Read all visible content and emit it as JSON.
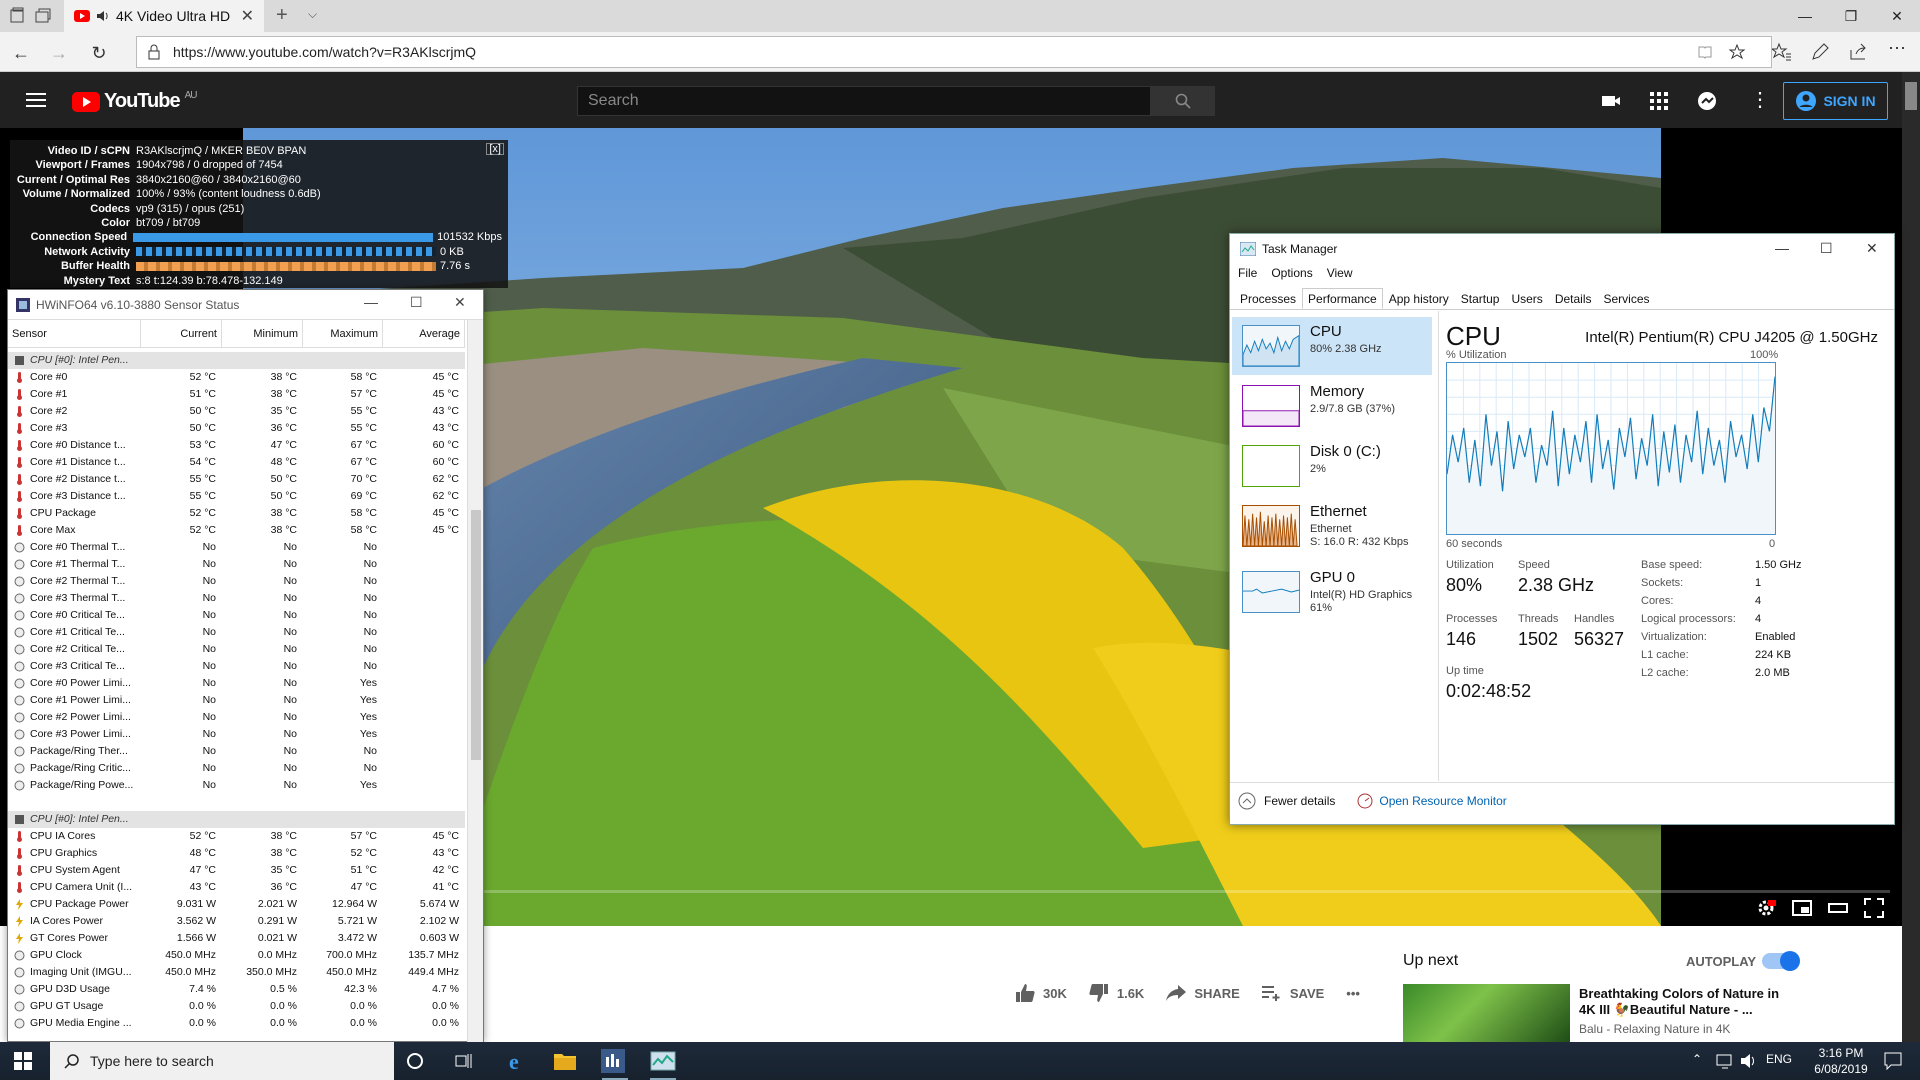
{
  "browser": {
    "tab_title": "4K Video Ultra HD",
    "url": "https://www.youtube.com/watch?v=R3AKlscrjmQ"
  },
  "youtube": {
    "logo_text": "YouTube",
    "region": "AU",
    "search_placeholder": "Search",
    "sign_in": "SIGN IN"
  },
  "stats": {
    "close": "[x]",
    "rows": [
      {
        "k": "Video ID / sCPN",
        "v": "R3AKlscrjmQ / MKER BE0V BPAN"
      },
      {
        "k": "Viewport / Frames",
        "v": "1904x798 / 0 dropped of 7454"
      },
      {
        "k": "Current / Optimal Res",
        "v": "3840x2160@60 / 3840x2160@60"
      },
      {
        "k": "Volume / Normalized",
        "v": "100% / 93% (content loudness 0.6dB)"
      },
      {
        "k": "Codecs",
        "v": "vp9 (315) / opus (251)"
      },
      {
        "k": "Color",
        "v": "bt709 / bt709"
      },
      {
        "k": "Connection Speed",
        "v": "101532 Kbps"
      },
      {
        "k": "Network Activity",
        "v": "0 KB"
      },
      {
        "k": "Buffer Health",
        "v": "7.76 s"
      },
      {
        "k": "Mystery Text",
        "v": "s:8 t:124.39 b:78.478-132.149"
      }
    ]
  },
  "below": {
    "likes": "30K",
    "dislikes": "1.6K",
    "share": "SHARE",
    "save": "SAVE",
    "more": "•••",
    "up_next": "Up next",
    "autoplay": "AUTOPLAY",
    "rec_title": "Breathtaking Colors of Nature in 4K III 🐓Beautiful Nature - ...",
    "rec_channel": "Balu - Relaxing Nature in 4K"
  },
  "hwinfo": {
    "title": "HWiNFO64 v6.10-3880 Sensor Status",
    "headers": [
      "Sensor",
      "Current",
      "Minimum",
      "Maximum",
      "Average"
    ],
    "rows": [
      {
        "t": "grp",
        "n": "CPU [#0]: Intel Pen..."
      },
      {
        "t": "temp",
        "n": "Core #0",
        "c": "52 °C",
        "mn": "38 °C",
        "mx": "58 °C",
        "av": "45 °C"
      },
      {
        "t": "temp",
        "n": "Core #1",
        "c": "51 °C",
        "mn": "38 °C",
        "mx": "57 °C",
        "av": "45 °C"
      },
      {
        "t": "temp",
        "n": "Core #2",
        "c": "50 °C",
        "mn": "35 °C",
        "mx": "55 °C",
        "av": "43 °C"
      },
      {
        "t": "temp",
        "n": "Core #3",
        "c": "50 °C",
        "mn": "36 °C",
        "mx": "55 °C",
        "av": "43 °C"
      },
      {
        "t": "temp",
        "n": "Core #0 Distance t...",
        "c": "53 °C",
        "mn": "47 °C",
        "mx": "67 °C",
        "av": "60 °C"
      },
      {
        "t": "temp",
        "n": "Core #1 Distance t...",
        "c": "54 °C",
        "mn": "48 °C",
        "mx": "67 °C",
        "av": "60 °C"
      },
      {
        "t": "temp",
        "n": "Core #2 Distance t...",
        "c": "55 °C",
        "mn": "50 °C",
        "mx": "70 °C",
        "av": "62 °C"
      },
      {
        "t": "temp",
        "n": "Core #3 Distance t...",
        "c": "55 °C",
        "mn": "50 °C",
        "mx": "69 °C",
        "av": "62 °C"
      },
      {
        "t": "temp",
        "n": "CPU Package",
        "c": "52 °C",
        "mn": "38 °C",
        "mx": "58 °C",
        "av": "45 °C"
      },
      {
        "t": "temp",
        "n": "Core Max",
        "c": "52 °C",
        "mn": "38 °C",
        "mx": "58 °C",
        "av": "45 °C"
      },
      {
        "t": "flag",
        "n": "Core #0 Thermal T...",
        "c": "No",
        "mn": "No",
        "mx": "No",
        "av": ""
      },
      {
        "t": "flag",
        "n": "Core #1 Thermal T...",
        "c": "No",
        "mn": "No",
        "mx": "No",
        "av": ""
      },
      {
        "t": "flag",
        "n": "Core #2 Thermal T...",
        "c": "No",
        "mn": "No",
        "mx": "No",
        "av": ""
      },
      {
        "t": "flag",
        "n": "Core #3 Thermal T...",
        "c": "No",
        "mn": "No",
        "mx": "No",
        "av": ""
      },
      {
        "t": "flag",
        "n": "Core #0 Critical Te...",
        "c": "No",
        "mn": "No",
        "mx": "No",
        "av": ""
      },
      {
        "t": "flag",
        "n": "Core #1 Critical Te...",
        "c": "No",
        "mn": "No",
        "mx": "No",
        "av": ""
      },
      {
        "t": "flag",
        "n": "Core #2 Critical Te...",
        "c": "No",
        "mn": "No",
        "mx": "No",
        "av": ""
      },
      {
        "t": "flag",
        "n": "Core #3 Critical Te...",
        "c": "No",
        "mn": "No",
        "mx": "No",
        "av": ""
      },
      {
        "t": "flag",
        "n": "Core #0 Power Limi...",
        "c": "No",
        "mn": "No",
        "mx": "Yes",
        "av": ""
      },
      {
        "t": "flag",
        "n": "Core #1 Power Limi...",
        "c": "No",
        "mn": "No",
        "mx": "Yes",
        "av": ""
      },
      {
        "t": "flag",
        "n": "Core #2 Power Limi...",
        "c": "No",
        "mn": "No",
        "mx": "Yes",
        "av": ""
      },
      {
        "t": "flag",
        "n": "Core #3 Power Limi...",
        "c": "No",
        "mn": "No",
        "mx": "Yes",
        "av": ""
      },
      {
        "t": "flag",
        "n": "Package/Ring Ther...",
        "c": "No",
        "mn": "No",
        "mx": "No",
        "av": ""
      },
      {
        "t": "flag",
        "n": "Package/Ring Critic...",
        "c": "No",
        "mn": "No",
        "mx": "No",
        "av": ""
      },
      {
        "t": "flag",
        "n": "Package/Ring Powe...",
        "c": "No",
        "mn": "No",
        "mx": "Yes",
        "av": ""
      },
      {
        "t": "blank",
        "n": ""
      },
      {
        "t": "grp",
        "n": "CPU [#0]: Intel Pen..."
      },
      {
        "t": "temp",
        "n": "CPU IA Cores",
        "c": "52 °C",
        "mn": "38 °C",
        "mx": "57 °C",
        "av": "45 °C"
      },
      {
        "t": "temp",
        "n": "CPU Graphics",
        "c": "48 °C",
        "mn": "38 °C",
        "mx": "52 °C",
        "av": "43 °C"
      },
      {
        "t": "temp",
        "n": "CPU System Agent",
        "c": "47 °C",
        "mn": "35 °C",
        "mx": "51 °C",
        "av": "42 °C"
      },
      {
        "t": "temp",
        "n": "CPU Camera Unit (I...",
        "c": "43 °C",
        "mn": "36 °C",
        "mx": "47 °C",
        "av": "41 °C"
      },
      {
        "t": "power",
        "n": "CPU Package Power",
        "c": "9.031 W",
        "mn": "2.021 W",
        "mx": "12.964 W",
        "av": "5.674 W"
      },
      {
        "t": "power",
        "n": "IA Cores Power",
        "c": "3.562 W",
        "mn": "0.291 W",
        "mx": "5.721 W",
        "av": "2.102 W"
      },
      {
        "t": "power",
        "n": "GT Cores Power",
        "c": "1.566 W",
        "mn": "0.021 W",
        "mx": "3.472 W",
        "av": "0.603 W"
      },
      {
        "t": "flag",
        "n": "GPU Clock",
        "c": "450.0 MHz",
        "mn": "0.0 MHz",
        "mx": "700.0 MHz",
        "av": "135.7 MHz"
      },
      {
        "t": "flag",
        "n": "Imaging Unit (IMGU...",
        "c": "450.0 MHz",
        "mn": "350.0 MHz",
        "mx": "450.0 MHz",
        "av": "449.4 MHz"
      },
      {
        "t": "flag",
        "n": "GPU D3D Usage",
        "c": "7.4 %",
        "mn": "0.5 %",
        "mx": "42.3 %",
        "av": "4.7 %"
      },
      {
        "t": "flag",
        "n": "GPU GT Usage",
        "c": "0.0 %",
        "mn": "0.0 %",
        "mx": "0.0 %",
        "av": "0.0 %"
      },
      {
        "t": "flag",
        "n": "GPU Media Engine ...",
        "c": "0.0 %",
        "mn": "0.0 %",
        "mx": "0.0 %",
        "av": "0.0 %"
      }
    ]
  },
  "taskmgr": {
    "title": "Task Manager",
    "menu": [
      "File",
      "Options",
      "View"
    ],
    "tabs": [
      "Processes",
      "Performance",
      "App history",
      "Startup",
      "Users",
      "Details",
      "Services"
    ],
    "active_tab": "Performance",
    "items": [
      {
        "name": "CPU",
        "l2": "80% 2.38 GHz",
        "l3": ""
      },
      {
        "name": "Memory",
        "l2": "2.9/7.8 GB (37%)",
        "l3": ""
      },
      {
        "name": "Disk 0 (C:)",
        "l2": "2%",
        "l3": ""
      },
      {
        "name": "Ethernet",
        "l2": "Ethernet",
        "l3": "S: 16.0  R: 432 Kbps"
      },
      {
        "name": "GPU 0",
        "l2": "Intel(R) HD Graphics",
        "l3": "61%"
      }
    ],
    "heading": "CPU",
    "cpu_name": "Intel(R) Pentium(R) CPU J4205 @ 1.50GHz",
    "util_label": "% Utilization",
    "max_label": "100%",
    "time_label": "60 seconds",
    "zero_label": "0",
    "utilization_label": "Utilization",
    "utilization": "80%",
    "speed_label": "Speed",
    "speed": "2.38 GHz",
    "processes_label": "Processes",
    "processes": "146",
    "threads_label": "Threads",
    "threads": "1502",
    "handles_label": "Handles",
    "handles": "56327",
    "uptime_label": "Up time",
    "uptime": "0:02:48:52",
    "specs": [
      {
        "k": "Base speed:",
        "v": "1.50 GHz"
      },
      {
        "k": "Sockets:",
        "v": "1"
      },
      {
        "k": "Cores:",
        "v": "4"
      },
      {
        "k": "Logical processors:",
        "v": "4"
      },
      {
        "k": "Virtualization:",
        "v": "Enabled"
      },
      {
        "k": "L1 cache:",
        "v": "224 KB"
      },
      {
        "k": "L2 cache:",
        "v": "2.0 MB"
      }
    ],
    "fewer_details": "Fewer details",
    "open_monitor": "Open Resource Monitor",
    "cpu_history": [
      35,
      58,
      42,
      62,
      30,
      55,
      28,
      70,
      40,
      60,
      25,
      66,
      38,
      58,
      45,
      62,
      30,
      52,
      40,
      72,
      28,
      62,
      35,
      58,
      42,
      66,
      30,
      70,
      38,
      55,
      26,
      62,
      45,
      68,
      32,
      56,
      40,
      70,
      28,
      60,
      36,
      64,
      30,
      58,
      42,
      72,
      35,
      62,
      40,
      55,
      30,
      66,
      45,
      58,
      38,
      70,
      42,
      74,
      60,
      92
    ]
  },
  "taskbar": {
    "search_placeholder": "Type here to search",
    "lang": "ENG",
    "time": "3:16 PM",
    "date": "6/08/2019"
  }
}
